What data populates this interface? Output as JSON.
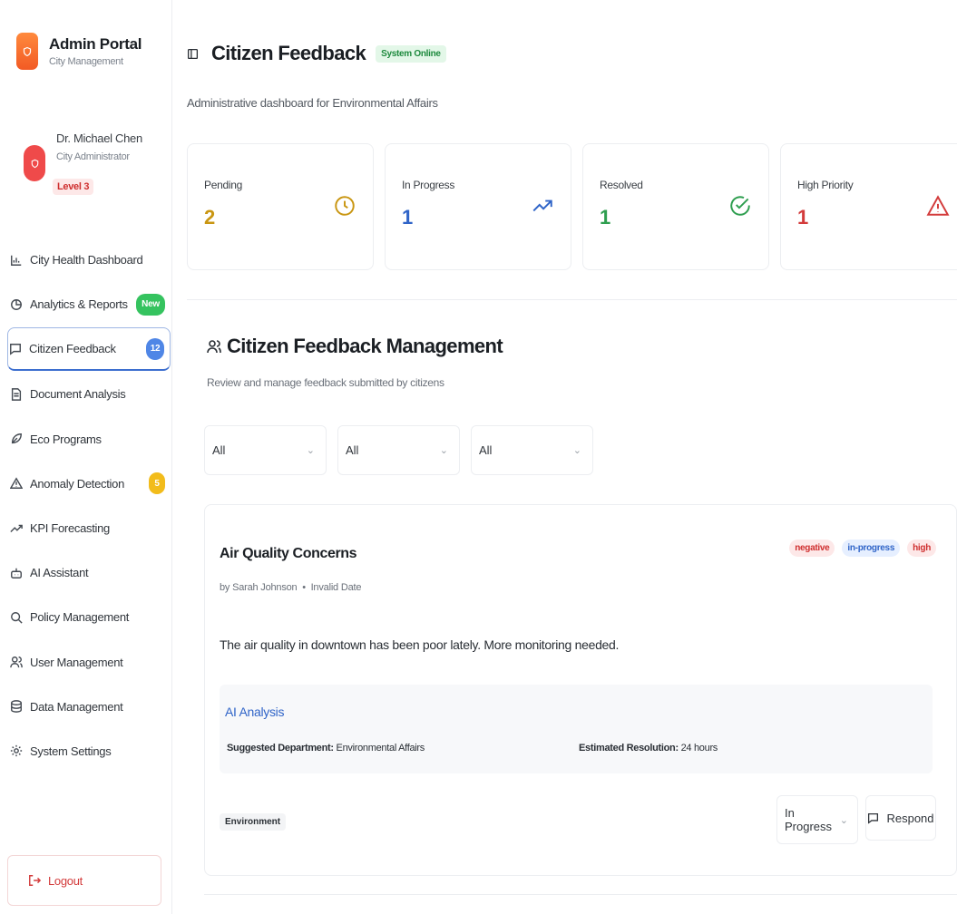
{
  "brand": {
    "title": "Admin Portal",
    "subtitle": "City Management"
  },
  "user": {
    "name": "Dr. Michael Chen",
    "role": "City Administrator",
    "level": "Level 3"
  },
  "nav": [
    {
      "label": "City Health Dashboard",
      "icon": "bar-chart-icon"
    },
    {
      "label": "Analytics & Reports",
      "icon": "pie-chart-icon",
      "badge": "New"
    },
    {
      "label": "Citizen Feedback",
      "icon": "message-square-icon",
      "badge": "12",
      "active": true
    },
    {
      "label": "Document Analysis",
      "icon": "file-text-icon"
    },
    {
      "label": "Eco Programs",
      "icon": "leaf-icon"
    },
    {
      "label": "Anomaly Detection",
      "icon": "alert-triangle-icon",
      "badge": "5"
    },
    {
      "label": "KPI Forecasting",
      "icon": "trending-up-icon"
    },
    {
      "label": "AI Assistant",
      "icon": "bot-icon"
    },
    {
      "label": "Policy Management",
      "icon": "search-icon"
    },
    {
      "label": "User Management",
      "icon": "users-icon"
    },
    {
      "label": "Data Management",
      "icon": "database-icon"
    },
    {
      "label": "System Settings",
      "icon": "settings-icon"
    }
  ],
  "logout_label": "Logout",
  "header": {
    "title": "Citizen Feedback",
    "status": "System Online",
    "subtitle": "Administrative dashboard for Environmental Affairs"
  },
  "stats": [
    {
      "label": "Pending",
      "value": "2",
      "color": "#c99612",
      "icon": "clock-icon"
    },
    {
      "label": "In Progress",
      "value": "1",
      "color": "#2f64c8",
      "icon": "trending-up-icon"
    },
    {
      "label": "Resolved",
      "value": "1",
      "color": "#2e9e4f",
      "icon": "check-circle-icon"
    },
    {
      "label": "High Priority",
      "value": "1",
      "color": "#d33b3b",
      "icon": "alert-triangle-icon"
    }
  ],
  "management": {
    "title": "Citizen Feedback Management",
    "subtitle": "Review and manage feedback submitted by citizens",
    "filters": [
      "All",
      "All",
      "All"
    ]
  },
  "feedback": {
    "title": "Air Quality Concerns",
    "author": "by Sarah Johnson",
    "date": "Invalid Date",
    "tags": [
      "negative",
      "in-progress",
      "high"
    ],
    "body": "The air quality in downtown has been poor lately. More monitoring needed.",
    "ai": {
      "title": "AI Analysis",
      "dept_label": "Suggested Department:",
      "dept_value": "Environmental Affairs",
      "res_label": "Estimated Resolution:",
      "res_value": "24 hours"
    },
    "category": "Environment",
    "status": "In Progress",
    "respond_label": "Respond"
  }
}
